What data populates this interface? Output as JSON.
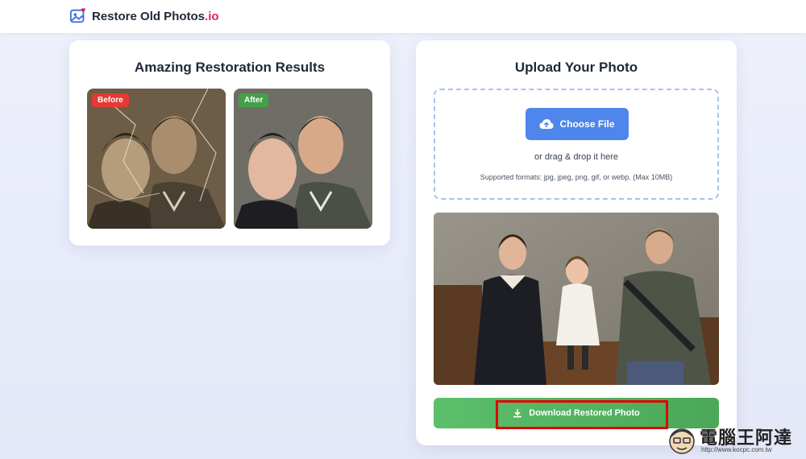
{
  "header": {
    "logo_text": "Restore Old Photos",
    "logo_suffix": ".io",
    "logo_icon": "image-heart-icon"
  },
  "results": {
    "title": "Amazing Restoration Results",
    "before_label": "Before",
    "after_label": "After"
  },
  "upload": {
    "title": "Upload Your Photo",
    "choose_label": "Choose File",
    "drag_text": "or drag & drop it here",
    "formats_text": "Supported formats: jpg, jpeg, png, gif, or webp. (Max 10MB)",
    "upload_icon": "cloud-upload-icon"
  },
  "download": {
    "label": "Download Restored Photo",
    "icon": "download-icon"
  },
  "watermark": {
    "text": "電腦王阿達",
    "url": "http://www.kocpc.com.tw"
  },
  "colors": {
    "accent_blue": "#4f86ec",
    "success_green": "#4aa858",
    "brand_pink": "#e11d6e",
    "before_badge": "#e53935",
    "after_badge": "#43a047",
    "highlight_red": "#e10000"
  }
}
